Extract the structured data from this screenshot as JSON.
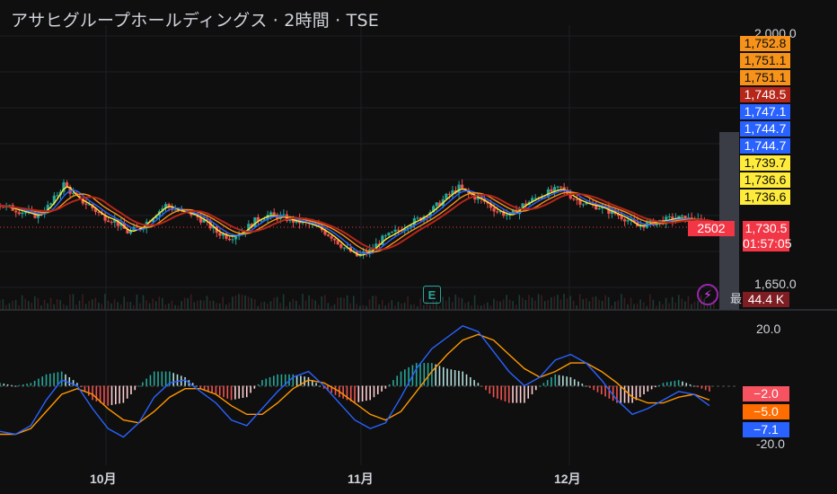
{
  "header": {
    "title": "アサヒグループホールディングス · 2時間 · TSE"
  },
  "price_axis": {
    "top_label": "2,000.0",
    "bottom_label": "1,650.0",
    "price_tags": [
      {
        "value": "1,752.8",
        "color": "#f7931a"
      },
      {
        "value": "1,751.1",
        "color": "#f7931a"
      },
      {
        "value": "1,751.1",
        "color": "#f7931a"
      },
      {
        "value": "1,748.5",
        "color": "#b5271b"
      },
      {
        "value": "1,747.1",
        "color": "#2962ff"
      },
      {
        "value": "1,744.7",
        "color": "#2962ff"
      },
      {
        "value": "1,744.7",
        "color": "#2962ff"
      },
      {
        "value": "1,739.7",
        "color": "#ffeb3b"
      },
      {
        "value": "1,736.6",
        "color": "#ffeb3b"
      },
      {
        "value": "1,736.6",
        "color": "#ffeb3b"
      }
    ],
    "last_price": "1,730.5",
    "countdown": "01:57:05",
    "symbol_tag": "2502",
    "volume_tag": "44.4 K",
    "partial_label": "最"
  },
  "macd_axis": {
    "top_label": "20.0",
    "bottom_label": "-20.0",
    "hist_tag": "−2.0",
    "signal_tag": "−5.0",
    "macd_tag": "−7.1"
  },
  "x_axis": {
    "labels": [
      "10月",
      "11月",
      "12月"
    ]
  },
  "markers": {
    "earnings_label": "E"
  },
  "chart_data": [
    {
      "type": "candlestick",
      "title": "アサヒグループホールディングス · 2時間 · TSE",
      "y_range": [
        1650,
        2000
      ],
      "price_series_key_points": {
        "x_month_ticks": [
          "10月",
          "11月",
          "12月"
        ],
        "close_path": [
          1760,
          1755,
          1750,
          1745,
          1762,
          1790,
          1770,
          1760,
          1745,
          1738,
          1722,
          1728,
          1745,
          1760,
          1752,
          1748,
          1738,
          1722,
          1715,
          1722,
          1738,
          1746,
          1744,
          1738,
          1735,
          1728,
          1716,
          1700,
          1688,
          1695,
          1712,
          1722,
          1733,
          1742,
          1755,
          1772,
          1785,
          1774,
          1765,
          1752,
          1745,
          1760,
          1770,
          1778,
          1784,
          1770,
          1762,
          1758,
          1750,
          1742,
          1730,
          1735,
          1738,
          1742,
          1740,
          1736,
          1730
        ]
      },
      "moving_averages": [
        {
          "color": "#ffeb3b",
          "last_value": 1736.6
        },
        {
          "color": "#2962ff",
          "last_value": 1744.7
        },
        {
          "color": "#f7931a",
          "last_value": 1751.1
        },
        {
          "color": "#b5271b",
          "last_value": 1748.5
        }
      ],
      "last_price": 1730.5
    },
    {
      "type": "macd",
      "y_range": [
        -20,
        20
      ],
      "macd_last": -7.1,
      "signal_last": -5.0,
      "histogram_last": -2.0,
      "macd_path": [
        -16,
        -17,
        -14,
        -5,
        2,
        0,
        -8,
        -15,
        -18,
        -13,
        -4,
        1,
        2,
        -2,
        -6,
        -12,
        -14,
        -8,
        -2,
        3,
        5,
        0,
        -6,
        -12,
        -15,
        -13,
        -4,
        6,
        13,
        17,
        21,
        19,
        12,
        5,
        0,
        3,
        9,
        11,
        8,
        2,
        -5,
        -10,
        -8,
        -5,
        -2,
        -3,
        -7
      ],
      "signal_path": [
        -17,
        -17,
        -15,
        -9,
        -3,
        -1,
        -3,
        -8,
        -12,
        -13,
        -9,
        -4,
        -1,
        -1,
        -3,
        -7,
        -10,
        -10,
        -6,
        -1,
        2,
        1,
        -2,
        -6,
        -10,
        -12,
        -9,
        -2,
        5,
        11,
        16,
        18,
        16,
        11,
        6,
        3,
        5,
        8,
        8,
        5,
        1,
        -4,
        -6,
        -6,
        -4,
        -3,
        -5
      ],
      "hist_path": [
        1,
        0,
        1,
        4,
        5,
        1,
        -5,
        -7,
        -6,
        0,
        5,
        5,
        3,
        -1,
        -3,
        -5,
        -4,
        2,
        4,
        4,
        3,
        -1,
        -4,
        -6,
        -5,
        -1,
        5,
        8,
        8,
        6,
        5,
        1,
        -4,
        -6,
        -6,
        0,
        4,
        3,
        0,
        -3,
        -6,
        -6,
        -2,
        1,
        2,
        0,
        -2
      ]
    }
  ]
}
